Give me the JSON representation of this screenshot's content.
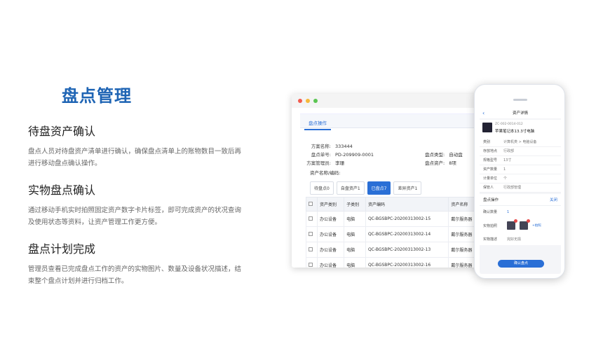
{
  "heading": "盘点管理",
  "features": [
    {
      "title": "待盘资产确认",
      "desc": "盘点人员对待盘资产清单进行确认，确保盘点清单上的账物数目一致后再进行移动盘点确认操作。"
    },
    {
      "title": "实物盘点确认",
      "desc": "通过移动手机实时拍照固定资产数字卡片标签，即可完成资产的状况查询及使用状态等资料，让资产管理工作更方便。"
    },
    {
      "title": "盘点计划完成",
      "desc": "管理员查看已完成盘点工作的资产的实物图片、数量及设备状况描述，结束整个盘点计划并进行归档工作。"
    }
  ],
  "window": {
    "tab": "盘点操作",
    "fields": {
      "plan_name_label": "方案名称:",
      "plan_name": "333444",
      "order_no_label": "盘点单号:",
      "order_no": "PD-209909-0001",
      "manager_label": "方案管理员:",
      "manager": "李珊",
      "type_label": "盘点类型:",
      "type": "自动盘",
      "assets_label": "盘点资产:",
      "assets": "8项",
      "search_label": "资产名称/编码:"
    },
    "subtabs": [
      "待盘点0",
      "自盘资产1",
      "已盘点7",
      "差异资产1"
    ],
    "table_headers": [
      "资产类别",
      "子类别",
      "资产编码",
      "资产名称"
    ],
    "rows": [
      {
        "category": "办公设备",
        "sub": "电脑",
        "code": "QC-BGSBPC-20200313002-15",
        "name": "戴尔服务器"
      },
      {
        "category": "办公设备",
        "sub": "电脑",
        "code": "QC-BGSBPC-20200313002-14",
        "name": "戴尔服务器"
      },
      {
        "category": "办公设备",
        "sub": "电脑",
        "code": "QC-BGSBPC-20200313002-13",
        "name": "戴尔服务器"
      },
      {
        "category": "办公设备",
        "sub": "电脑",
        "code": "QC-BGSBPC-20200313002-16",
        "name": "戴尔服务器"
      }
    ]
  },
  "phone": {
    "title": "资产详情",
    "item_code": "ZC-002-0014-012",
    "item_name": "苹果笔记本13.3寸电脑",
    "props": [
      {
        "k": "类别",
        "v": "计算机类 > 电脑设备"
      },
      {
        "k": "存放地点",
        "v": "行政部"
      },
      {
        "k": "规格型号",
        "v": "13寸"
      },
      {
        "k": "资产数量",
        "v": "1"
      },
      {
        "k": "计量单位",
        "v": "个"
      },
      {
        "k": "保管人",
        "v": "行政部管理"
      }
    ],
    "ops_title": "盘点操作",
    "ops_close": "关闭",
    "confirm_qty_label": "确认数量",
    "confirm_qty": "1",
    "photo_label": "实物拍照",
    "add_label": "+拍照",
    "desc_label": "实物描述",
    "desc_value": "完好无损",
    "confirm_button": "确认盘点"
  }
}
